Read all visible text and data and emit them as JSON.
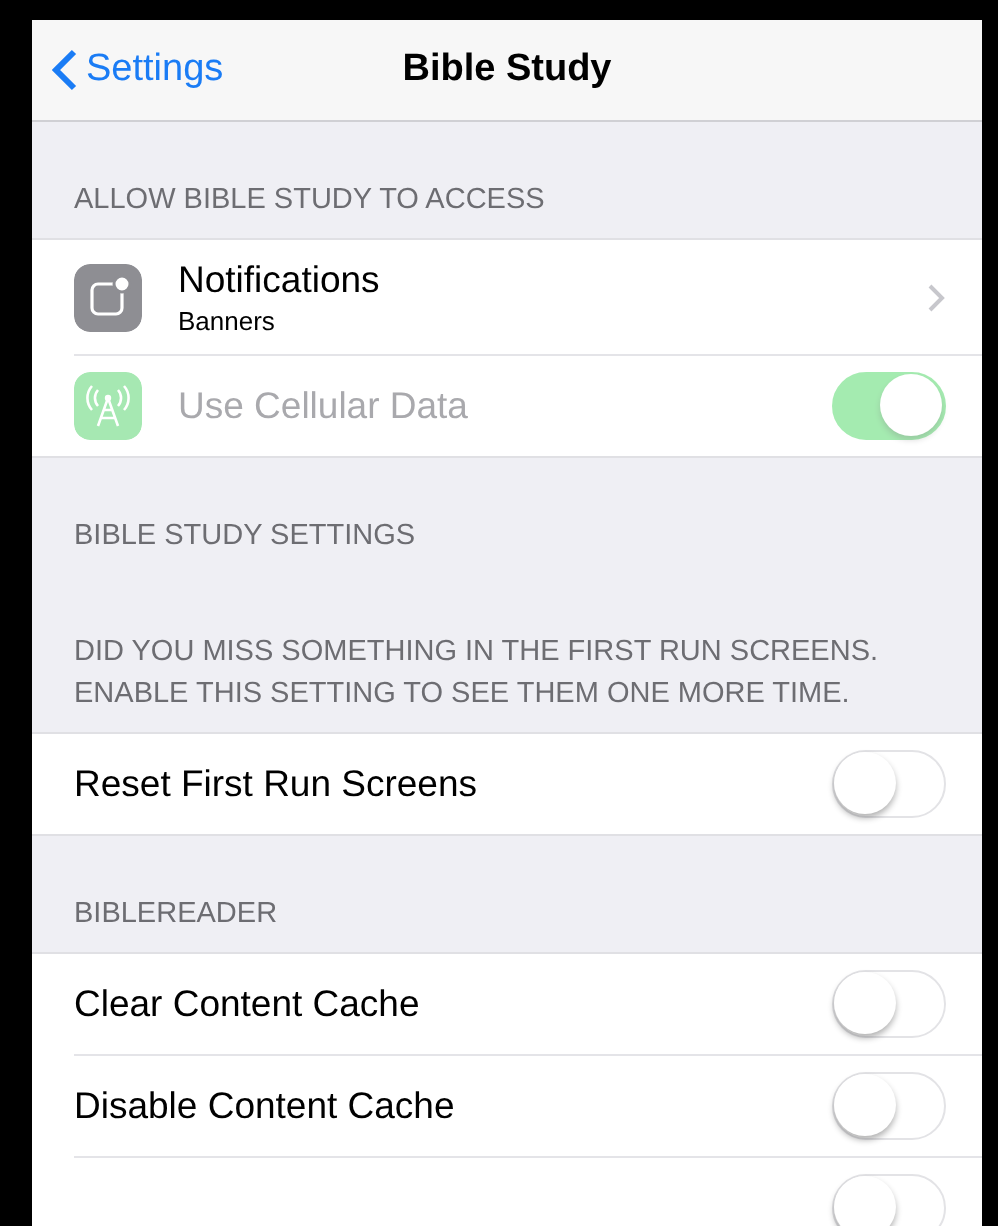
{
  "nav_bar": {
    "back": "Settings",
    "title": "Bible Study"
  },
  "sections": [
    {
      "header": "ALLOW BIBLE STUDY TO ACCESS",
      "rows": [
        {
          "kind": "detail",
          "title": "Notifications",
          "subtitle": "Banners"
        },
        {
          "kind": "app_toggle",
          "label": "Use Cellular Data",
          "on": true,
          "disabled": true
        }
      ]
    },
    {
      "header": "BIBLE STUDY SETTINGS"
    },
    {
      "header": "DID YOU MISS SOMETHING IN THE FIRST RUN SCREENS. ENABLE THIS SETTING TO SEE THEM ONE MORE TIME.",
      "rows": [
        {
          "kind": "toggle",
          "label": "Reset First Run Screens",
          "on": false,
          "disabled": false
        }
      ]
    },
    {
      "header": "BIBLEREADER",
      "rows": [
        {
          "kind": "toggle",
          "label": "Clear Content Cache",
          "on": false,
          "disabled": false
        },
        {
          "kind": "toggle",
          "label": "Disable Content Cache",
          "on": false,
          "disabled": false
        },
        {
          "kind": "toggle",
          "on": false,
          "disabled": false
        }
      ]
    }
  ]
}
